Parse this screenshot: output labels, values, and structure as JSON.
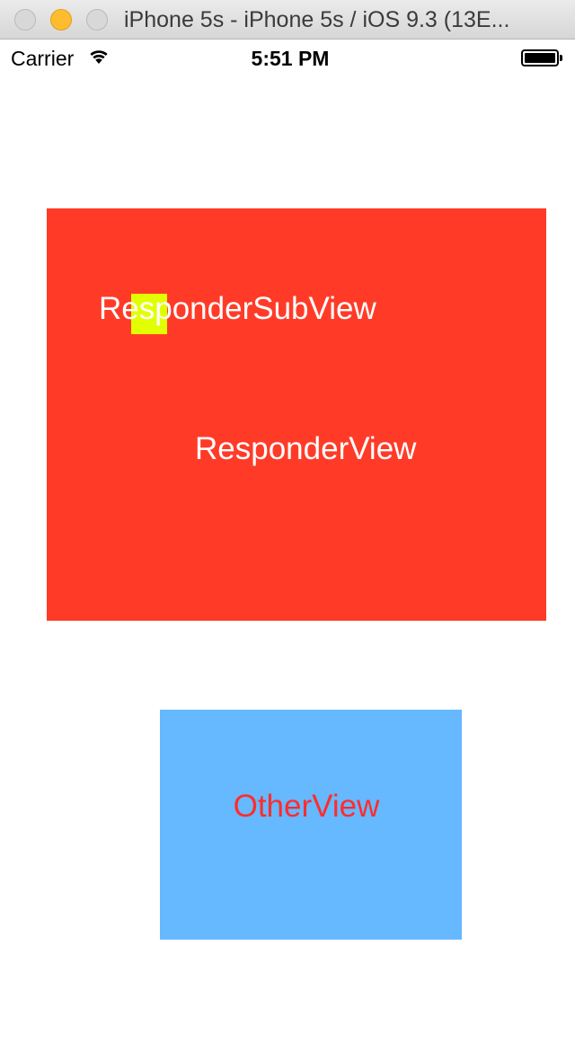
{
  "window": {
    "title": "iPhone 5s - iPhone 5s / iOS 9.3 (13E..."
  },
  "statusbar": {
    "carrier": "Carrier",
    "time": "5:51 PM",
    "wifi_icon": "wifi-icon",
    "battery_icon": "battery-icon",
    "battery_level": 1.0
  },
  "responder_view": {
    "label": "ResponderView",
    "background": "#ff3b28",
    "text_color": "#ffffff"
  },
  "responder_subview": {
    "label": "ResponderSubView",
    "background": "#e1ff00",
    "text_color": "#ffffff"
  },
  "other_view": {
    "label": "OtherView",
    "background": "#66b8ff",
    "text_color": "#ff2d2d"
  }
}
